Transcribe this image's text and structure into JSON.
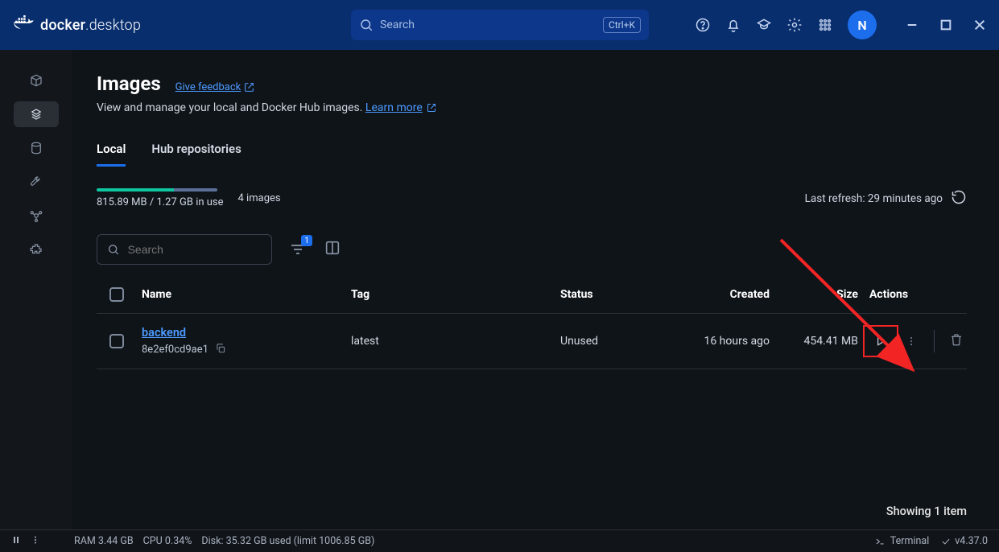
{
  "titlebar": {
    "logo_text_bold": "docker",
    "logo_text_light": "desktop",
    "search_placeholder": "Search",
    "search_shortcut": "Ctrl+K",
    "avatar_letter": "N"
  },
  "sidebar": {
    "items": [
      {
        "name": "containers"
      },
      {
        "name": "images",
        "active": true
      },
      {
        "name": "volumes"
      },
      {
        "name": "builds"
      },
      {
        "name": "dev-environments"
      },
      {
        "name": "extensions"
      }
    ]
  },
  "page": {
    "title": "Images",
    "feedback_label": "Give feedback",
    "subtitle_prefix": "View and manage your local and Docker Hub images. ",
    "learn_more_label": "Learn more"
  },
  "tabs": {
    "local": "Local",
    "hub": "Hub repositories"
  },
  "usage": {
    "used_label": "815.89 MB / 1.27 GB in use",
    "count_label": "4 images",
    "used_pct": 64,
    "last_refresh": "Last refresh: 29 minutes ago"
  },
  "toolbar": {
    "search_placeholder": "Search",
    "filter_badge": "1"
  },
  "table": {
    "headers": {
      "name": "Name",
      "tag": "Tag",
      "status": "Status",
      "created": "Created",
      "size": "Size",
      "actions": "Actions"
    },
    "rows": [
      {
        "name": "backend",
        "id": "8e2ef0cd9ae1",
        "tag": "latest",
        "status": "Unused",
        "created": "16 hours ago",
        "size": "454.41 MB"
      }
    ]
  },
  "footer": {
    "showing": "Showing 1 item"
  },
  "statusbar": {
    "ram": "RAM 3.44 GB",
    "cpu": "CPU 0.34%",
    "disk": "Disk: 35.32 GB used (limit 1006.85 GB)",
    "terminal": "Terminal",
    "version": "v4.37.0"
  }
}
